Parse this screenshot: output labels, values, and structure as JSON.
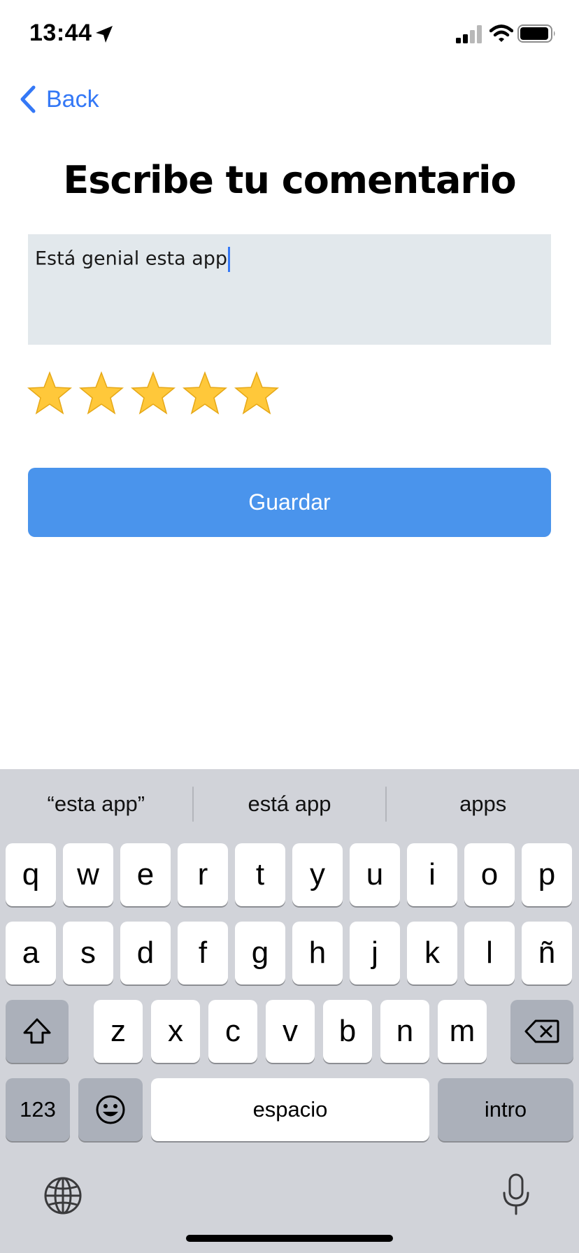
{
  "status_bar": {
    "time": "13:44",
    "icons": [
      "location-arrow-icon",
      "signal-icon",
      "wifi-icon",
      "battery-icon"
    ]
  },
  "nav": {
    "back_label": "Back"
  },
  "page": {
    "title": "Escribe tu comentario",
    "comment_value": "Está genial esta app",
    "rating": {
      "value": 5,
      "max": 5
    },
    "save_label": "Guardar"
  },
  "colors": {
    "accent": "#3478f6",
    "button": "#4a94ec",
    "input_bg": "#e2e8ec",
    "star": "#ffc83a",
    "keyboard_bg": "#d1d3d9"
  },
  "keyboard": {
    "suggestions": [
      "“esta app”",
      "está app",
      "apps"
    ],
    "row1": [
      "q",
      "w",
      "e",
      "r",
      "t",
      "y",
      "u",
      "i",
      "o",
      "p"
    ],
    "row2": [
      "a",
      "s",
      "d",
      "f",
      "g",
      "h",
      "j",
      "k",
      "l",
      "ñ"
    ],
    "row3": [
      "z",
      "x",
      "c",
      "v",
      "b",
      "n",
      "m"
    ],
    "numbers_label": "123",
    "space_label": "espacio",
    "return_label": "intro",
    "icons": [
      "shift-icon",
      "backspace-icon",
      "emoji-icon",
      "globe-icon",
      "microphone-icon"
    ]
  }
}
